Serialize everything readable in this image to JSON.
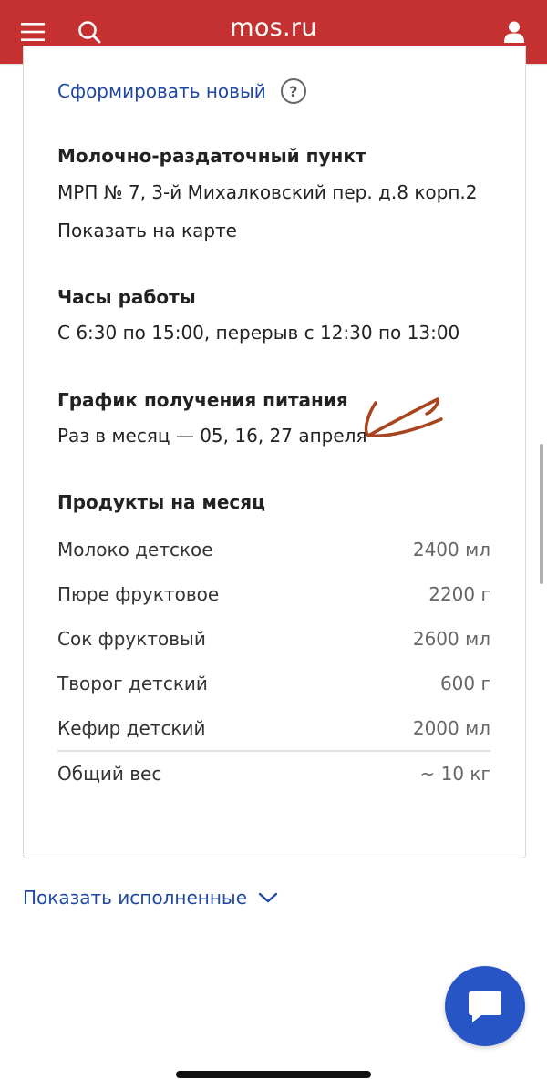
{
  "header": {
    "logo": "mos.ru",
    "menu_icon": "hamburger-menu-icon",
    "search_icon": "search-icon",
    "user_icon": "user-icon",
    "background_color": "#c53131"
  },
  "card": {
    "generate_link": "Сформировать новый",
    "help_icon": "?",
    "pickup_point": {
      "heading": "Молочно-раздаточный пункт",
      "address": "МРП № 7, 3-й Михалковский пер. д.8 корп.2",
      "map_link": "Показать на карте"
    },
    "hours": {
      "heading": "Часы работы",
      "text": "С 6:30 по 15:00, перерыв с 12:30 по 13:00"
    },
    "schedule": {
      "heading": "График получения питания",
      "text": "Раз в месяц — 05, 16, 27 апреля"
    },
    "products": {
      "heading": "Продукты на месяц",
      "items": [
        {
          "name": "Молоко детское",
          "qty": "2400 мл"
        },
        {
          "name": "Пюре фруктовое",
          "qty": "2200 г"
        },
        {
          "name": "Сок фруктовый",
          "qty": "2600 мл"
        },
        {
          "name": "Творог детский",
          "qty": "600 г"
        },
        {
          "name": "Кефир детский",
          "qty": "2000 мл"
        }
      ],
      "total_label": "Общий вес",
      "total_value": "~ 10 кг"
    }
  },
  "show_completed": "Показать исполненные",
  "chat_icon": "chat-bubble-icon",
  "colors": {
    "link": "#2048a3",
    "chat_button": "#2755c6",
    "annotation": "#a8441e"
  }
}
